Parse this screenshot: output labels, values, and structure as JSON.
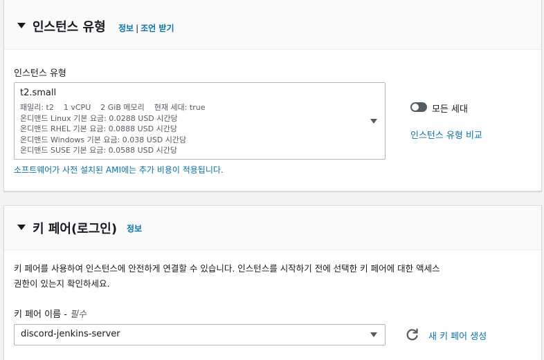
{
  "instance_type_section": {
    "title": "인스턴스 유형",
    "info_link": "정보",
    "separator": "|",
    "advice_link": "조언 받기",
    "field_label": "인스턴스 유형",
    "selected": {
      "name": "t2.small",
      "family": "패밀리: t2",
      "vcpu": "1 vCPU",
      "memory": "2 GiB 메모리",
      "current_gen": "현재 세대: true",
      "linux_price": "온디맨드 Linux 기본 요금: 0.0288 USD 시간당",
      "rhel_price": "온디맨드 RHEL 기본 요금: 0.0888 USD 시간당",
      "windows_price": "온디맨드 Windows 기본 요금: 0.038 USD 시간당",
      "suse_price": "온디맨드 SUSE 기본 요금: 0.0588 USD 시간당"
    },
    "all_generations_label": "모든 세대",
    "all_generations_on": false,
    "compare_link": "인스턴스 유형 비교",
    "ami_note": "소프트웨어가 사전 설치된 AMI에는 추가 비용이 적용됩니다."
  },
  "key_pair_section": {
    "title": "키 페어(로그인)",
    "info_link": "정보",
    "description_line1": "키 페어를 사용하여 인스턴스에 안전하게 연결할 수 있습니다. 인스턴스를 시작하기 전에 선택한 키 페어에 대한 액세스",
    "description_line2": "권한이 있는지 확인하세요.",
    "field_label": "키 페어 이름 - ",
    "required_label": "필수",
    "selected_value": "discord-jenkins-server",
    "create_link": "새 키 페어 생성"
  },
  "colors": {
    "link": "#0073bb",
    "text": "#16191f",
    "muted": "#545b64",
    "border": "#aab7b8",
    "background": "#f2f3f3"
  },
  "icons": [
    "caret-down-icon",
    "refresh-icon",
    "toggle-icon"
  ]
}
